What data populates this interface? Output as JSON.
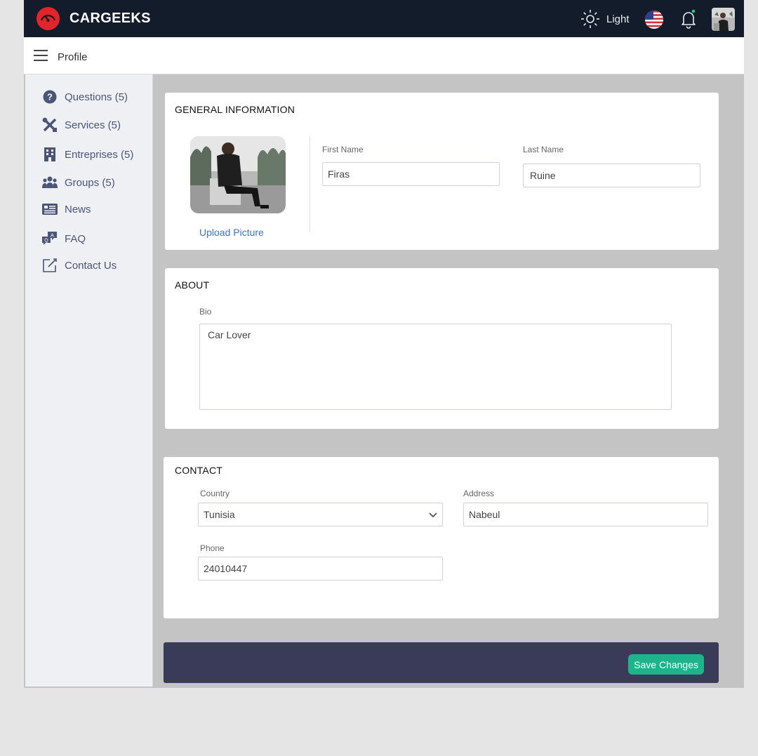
{
  "header": {
    "brand": "CARGEEKS",
    "theme_label": "Light",
    "accent_color": "#e3242b",
    "bar_color": "#121c2b"
  },
  "subheader": {
    "breadcrumb": "Profile"
  },
  "sidebar": {
    "items": [
      {
        "label": "Questions (5)",
        "icon": "question-circle-icon"
      },
      {
        "label": "Services (5)",
        "icon": "tools-icon"
      },
      {
        "label": "Entreprises (5)",
        "icon": "building-icon"
      },
      {
        "label": "Groups (5)",
        "icon": "users-icon"
      },
      {
        "label": "News",
        "icon": "newspaper-icon"
      },
      {
        "label": "FAQ",
        "icon": "faq-chat-icon"
      },
      {
        "label": "Contact Us",
        "icon": "edit-square-icon"
      }
    ]
  },
  "general": {
    "title": "GENERAL INFORMATION",
    "upload_label": "Upload Picture",
    "first_name_label": "First Name",
    "first_name_value": "Firas",
    "last_name_label": "Last Name",
    "last_name_value": "Ruine"
  },
  "about": {
    "title": "ABOUT",
    "bio_label": "Bio",
    "bio_value": "Car Lover"
  },
  "contact": {
    "title": "CONTACT",
    "country_label": "Country",
    "country_value": "Tunisia",
    "address_label": "Address",
    "address_value": "Nabeul",
    "phone_label": "Phone",
    "phone_value": "24010447"
  },
  "actions": {
    "save_label": "Save Changes",
    "save_color": "#1eb48b"
  }
}
